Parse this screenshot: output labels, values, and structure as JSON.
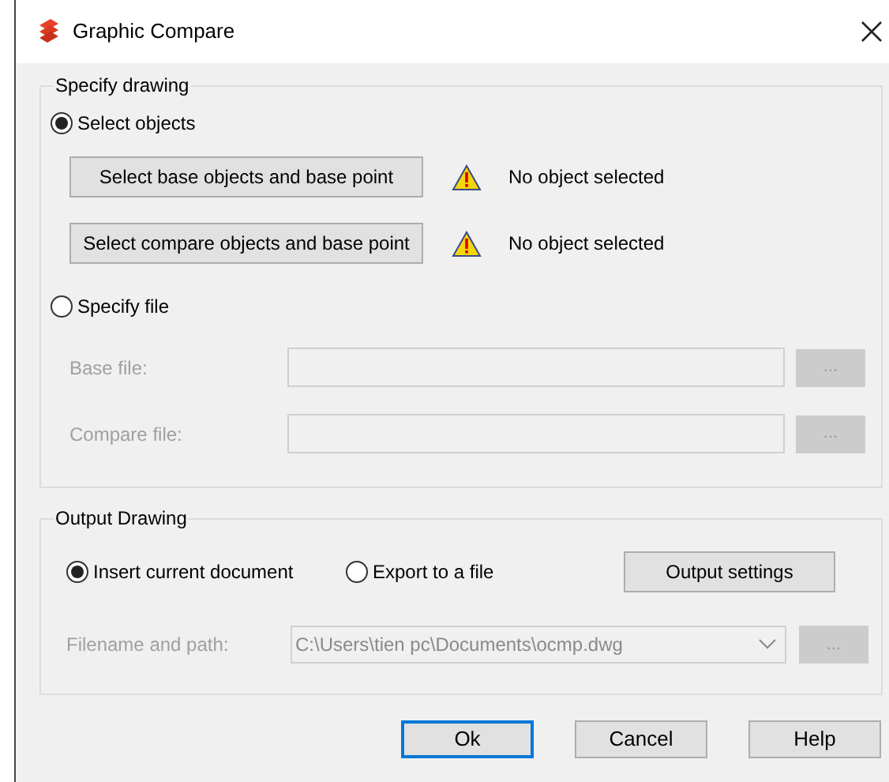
{
  "window": {
    "title": "Graphic Compare"
  },
  "specify_drawing": {
    "title": "Specify drawing",
    "select_objects": {
      "label": "Select objects",
      "selected": true
    },
    "selections": [
      {
        "button": "Select base objects and base point",
        "status": "No object selected",
        "warning": true
      },
      {
        "button": "Select compare objects and base point",
        "status": "No object selected",
        "warning": true
      }
    ],
    "specify_file": {
      "label": "Specify file",
      "selected": false
    },
    "files": [
      {
        "label": "Base file:",
        "disabled": true,
        "browse": "..."
      },
      {
        "label": "Compare file:",
        "disabled": true,
        "browse": "..."
      }
    ]
  },
  "output_drawing": {
    "title": "Output Drawing",
    "options": [
      {
        "label": "Insert current document",
        "selected": true
      },
      {
        "label": "Export to a file",
        "selected": false
      }
    ],
    "settings_button": "Output settings",
    "path": {
      "label": "Filename and path:",
      "value": "C:\\Users\\tien pc\\Documents\\ocmp.dwg",
      "disabled": true,
      "browse": "..."
    }
  },
  "buttons": [
    {
      "label": "Ok",
      "default": true
    },
    {
      "label": "Cancel",
      "default": false
    },
    {
      "label": "Help",
      "default": false
    }
  ]
}
